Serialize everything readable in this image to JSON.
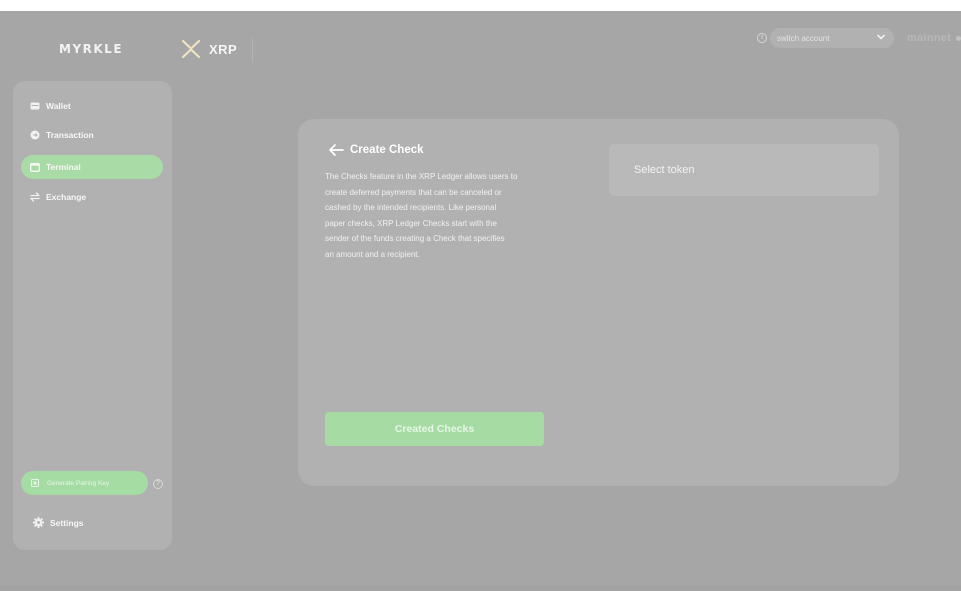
{
  "header": {
    "logo": "MYRKLE",
    "chain_name": "XRP",
    "account_placeholder": "switch account",
    "network": "mainnet"
  },
  "sidebar": {
    "items": [
      {
        "label": "Wallet",
        "icon": "wallet-icon",
        "active": false
      },
      {
        "label": "Transaction",
        "icon": "transaction-icon",
        "active": false
      },
      {
        "label": "Terminal",
        "icon": "terminal-icon",
        "active": true
      },
      {
        "label": "Exchange",
        "icon": "exchange-icon",
        "active": false
      }
    ],
    "pairing_button": "Generate Pairing Key",
    "settings": "Settings"
  },
  "main": {
    "title": "Create Check",
    "description_lines": [
      "The Checks feature in the XRP Ledger allows users to",
      "create deferred payments that can be canceled or",
      "cashed by the intended recipients. Like personal",
      "paper checks, XRP Ledger Checks start with the",
      "sender of the funds creating a Check that specifies",
      "an amount and a recipient."
    ],
    "token_select": "Select token",
    "created_checks_button": "Created Checks"
  },
  "colors": {
    "accent_green": "#a6dca4",
    "background": "#a6a6a6",
    "panel": "#b1b1b1"
  }
}
